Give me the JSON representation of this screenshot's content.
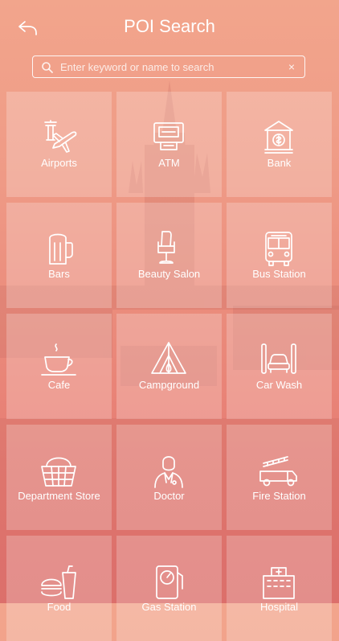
{
  "header": {
    "title": "POI Search"
  },
  "search": {
    "placeholder": "Enter keyword or name to search",
    "value": "",
    "clear_icon": "×"
  },
  "categories": [
    {
      "label": "Airports",
      "icon": "airport-icon"
    },
    {
      "label": "ATM",
      "icon": "atm-icon"
    },
    {
      "label": "Bank",
      "icon": "bank-icon"
    },
    {
      "label": "Bars",
      "icon": "beer-icon"
    },
    {
      "label": "Beauty Salon",
      "icon": "salon-chair-icon"
    },
    {
      "label": "Bus Station",
      "icon": "bus-icon"
    },
    {
      "label": "Cafe",
      "icon": "coffee-cup-icon"
    },
    {
      "label": "Campground",
      "icon": "tent-icon"
    },
    {
      "label": "Car Wash",
      "icon": "car-wash-icon"
    },
    {
      "label": "Department Store",
      "icon": "basket-icon"
    },
    {
      "label": "Doctor",
      "icon": "doctor-icon"
    },
    {
      "label": "Fire Station",
      "icon": "fire-truck-icon"
    },
    {
      "label": "Food",
      "icon": "fast-food-icon"
    },
    {
      "label": "Gas Station",
      "icon": "gas-pump-icon"
    },
    {
      "label": "Hospital",
      "icon": "hospital-icon"
    }
  ]
}
